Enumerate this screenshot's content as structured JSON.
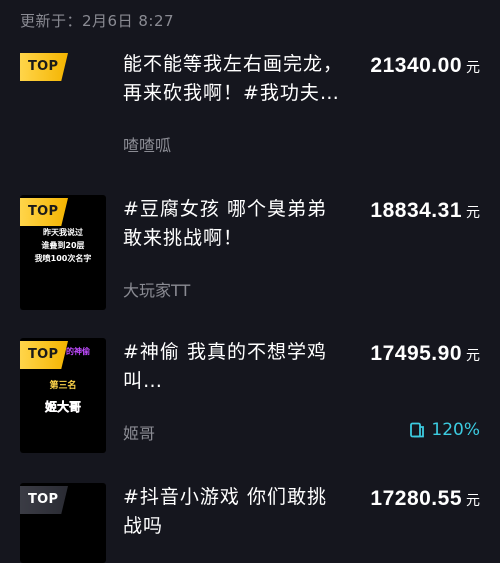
{
  "header": {
    "updated": "更新于：2月6日 8:27"
  },
  "rows": [
    {
      "rank": "TOP 1",
      "title": "能不能等我左右画完龙，再来砍我啊！#我功夫…",
      "author": "喳喳呱",
      "amount": "21340.00",
      "unit": "元",
      "thumb_lines": []
    },
    {
      "rank": "TOP 2",
      "title": "#豆腐女孩 哪个臭弟弟敢来挑战啊！",
      "author": "大玩家TT",
      "amount": "18834.31",
      "unit": "元",
      "thumb_lines": [
        "昨天我说过",
        "谁叠到20层",
        "我喷100次名字"
      ]
    },
    {
      "rank": "TOP 3",
      "title": "#神偷 我真的不想学鸡叫…",
      "author": "姬哥",
      "amount": "17495.90",
      "unit": "元",
      "growth": "120%",
      "thumb_lines": [
        "的神偷",
        "第三名",
        "姬大哥"
      ]
    },
    {
      "rank": "TOP 4",
      "title": "#抖音小游戏 你们敢挑战吗",
      "author": "",
      "amount": "17280.55",
      "unit": "元",
      "thumb_lines": []
    }
  ]
}
